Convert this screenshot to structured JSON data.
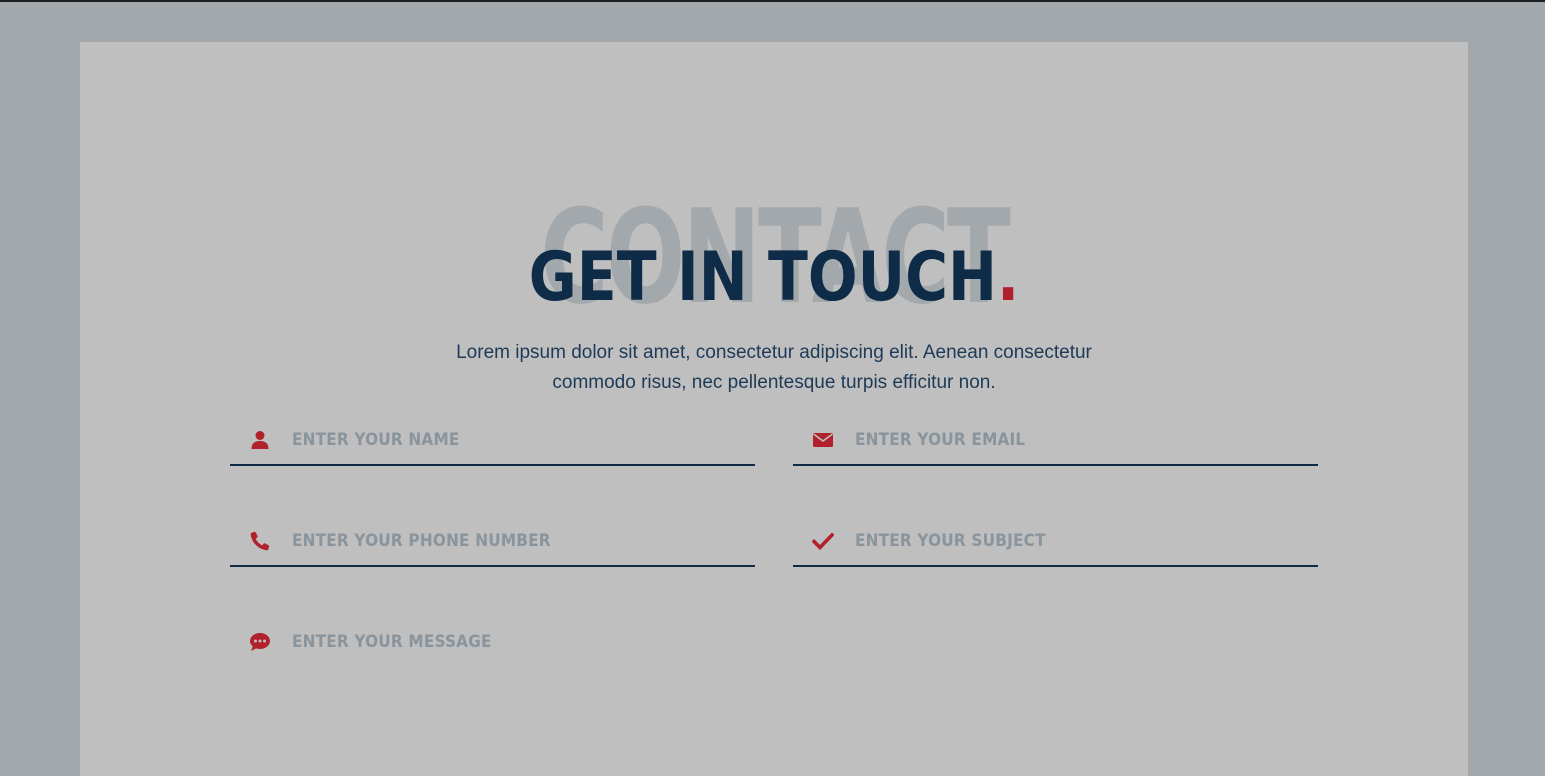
{
  "section": {
    "background_word": "CONTACT",
    "title": "GET IN TOUCH",
    "title_dot": ".",
    "intro_line1": "Lorem ipsum dolor sit amet, consectetur adipiscing elit. Aenean consectetur",
    "intro_line2": "commodo risus, nec pellentesque turpis efficitur non."
  },
  "form": {
    "name": {
      "placeholder": "ENTER YOUR NAME",
      "value": "",
      "icon": "user-icon"
    },
    "email": {
      "placeholder": "ENTER YOUR EMAIL",
      "value": "",
      "icon": "envelope-icon"
    },
    "phone": {
      "placeholder": "ENTER YOUR PHONE NUMBER",
      "value": "",
      "icon": "phone-icon"
    },
    "subject": {
      "placeholder": "ENTER YOUR SUBJECT",
      "value": "",
      "icon": "check-icon"
    },
    "message": {
      "placeholder": "ENTER YOUR MESSAGE",
      "value": "",
      "icon": "chat-bubble-icon"
    }
  },
  "colors": {
    "page_background": "#a3a8ac",
    "panel_background": "#bfbfbf",
    "title": "#0e2b47",
    "accent": "#b1212b",
    "placeholder": "#8a949c",
    "underline": "#0f2a44"
  }
}
